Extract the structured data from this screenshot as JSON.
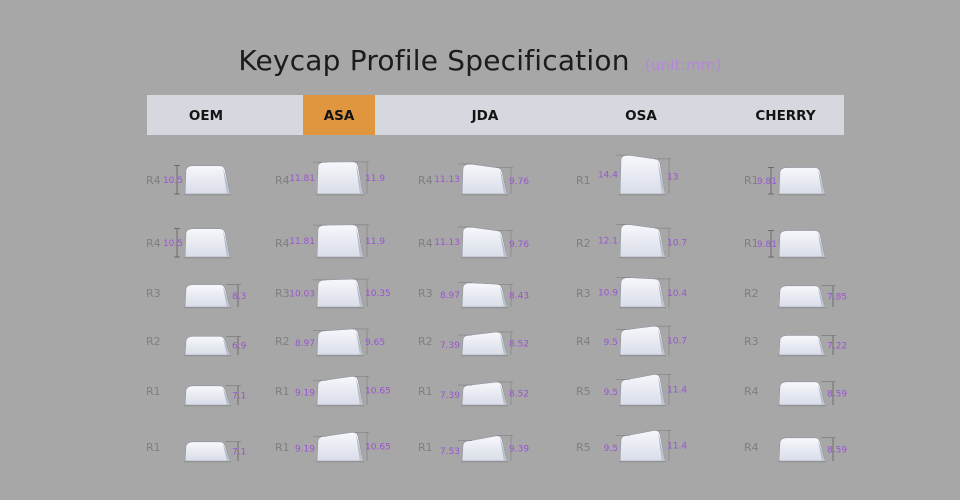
{
  "title": "Keycap Profile Specification",
  "unit": "(unit:mm)",
  "profiles": [
    {
      "name": "OEM",
      "active": false,
      "rows": [
        {
          "row": "R4",
          "left": "10.5",
          "right": ""
        },
        {
          "row": "R4",
          "left": "10.5",
          "right": ""
        },
        {
          "row": "R3",
          "left": "",
          "right": "8.3"
        },
        {
          "row": "R2",
          "left": "",
          "right": "6.9"
        },
        {
          "row": "R1",
          "left": "",
          "right": "7.1"
        },
        {
          "row": "R1",
          "left": "",
          "right": "7.1"
        }
      ]
    },
    {
      "name": "ASA",
      "active": true,
      "rows": [
        {
          "row": "R4",
          "left": "11.81",
          "right": "11.9"
        },
        {
          "row": "R4",
          "left": "11.81",
          "right": "11.9"
        },
        {
          "row": "R3",
          "left": "10.03",
          "right": "10.35"
        },
        {
          "row": "R2",
          "left": "8.97",
          "right": "9.65"
        },
        {
          "row": "R1",
          "left": "9.19",
          "right": "10.65"
        },
        {
          "row": "R1",
          "left": "9.19",
          "right": "10.65"
        }
      ]
    },
    {
      "name": "JDA",
      "active": false,
      "rows": [
        {
          "row": "R4",
          "left": "11.13",
          "right": "9.76"
        },
        {
          "row": "R4",
          "left": "11.13",
          "right": "9.76"
        },
        {
          "row": "R3",
          "left": "8.97",
          "right": "8.43"
        },
        {
          "row": "R2",
          "left": "7.39",
          "right": "8.52"
        },
        {
          "row": "R1",
          "left": "7.39",
          "right": "8.52"
        },
        {
          "row": "R1",
          "left": "7.53",
          "right": "9.39"
        }
      ]
    },
    {
      "name": "OSA",
      "active": false,
      "rows": [
        {
          "row": "R1",
          "left": "14.4",
          "right": "13"
        },
        {
          "row": "R2",
          "left": "12.1",
          "right": "10.7"
        },
        {
          "row": "R3",
          "left": "10.9",
          "right": "10.4"
        },
        {
          "row": "R4",
          "left": "9.5",
          "right": "10.7"
        },
        {
          "row": "R5",
          "left": "9.5",
          "right": "11.4"
        },
        {
          "row": "R5",
          "left": "9.5",
          "right": "11.4"
        }
      ]
    },
    {
      "name": "CHERRY",
      "active": false,
      "rows": [
        {
          "row": "R1",
          "left": "9.81",
          "right": ""
        },
        {
          "row": "R1",
          "left": "9.81",
          "right": ""
        },
        {
          "row": "R2",
          "left": "",
          "right": "7.85"
        },
        {
          "row": "R3",
          "left": "",
          "right": "7.22"
        },
        {
          "row": "R4",
          "left": "",
          "right": "8.59"
        },
        {
          "row": "R4",
          "left": "",
          "right": "8.59"
        }
      ]
    }
  ],
  "colors": {
    "background": "#a7a7a7",
    "header_bg": "#d6d8df",
    "active_tab": "#e0963f",
    "measure_text": "#9a54d2",
    "unit_text": "#b487d8"
  }
}
